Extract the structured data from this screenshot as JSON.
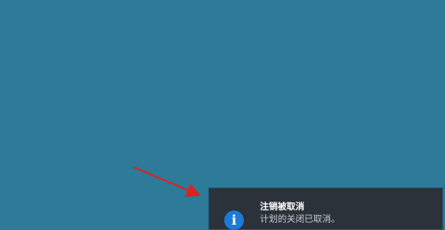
{
  "desktop": {
    "background_color": "#2d7a99"
  },
  "annotation": {
    "arrow_color": "#e02020"
  },
  "notification": {
    "icon": "info-icon",
    "icon_glyph": "i",
    "accent_color": "#1e7ad8",
    "background_color": "#2b3239",
    "title": "注销被取消",
    "message": "计划的关闭已取消。"
  }
}
